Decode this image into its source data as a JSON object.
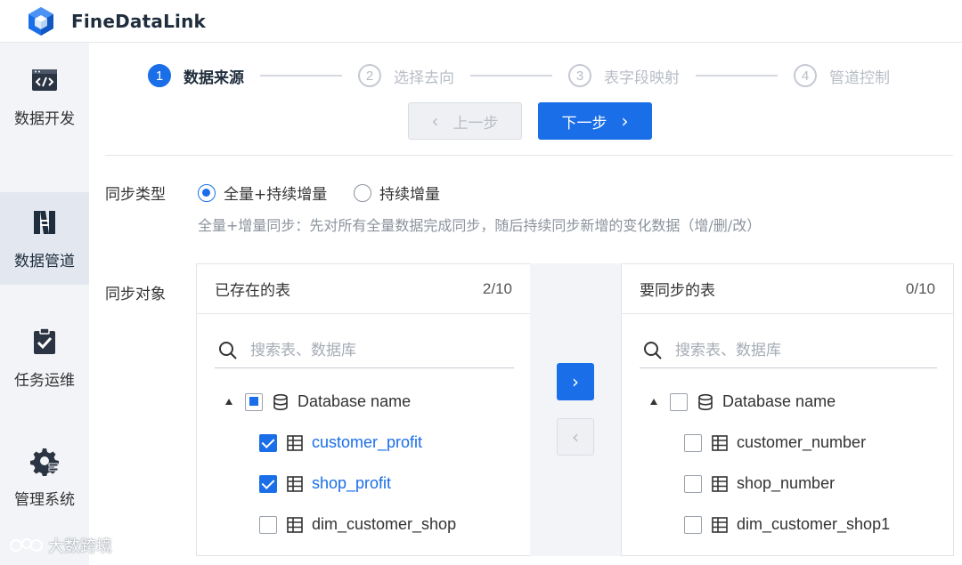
{
  "app": {
    "title": "FineDataLink"
  },
  "sidebar": {
    "items": [
      {
        "label": "数据开发",
        "icon": "code-icon",
        "active": false
      },
      {
        "label": "数据管道",
        "icon": "pipeline-icon",
        "active": true
      },
      {
        "label": "任务运维",
        "icon": "task-check-icon",
        "active": false
      },
      {
        "label": "管理系统",
        "icon": "gear-icon",
        "active": false
      }
    ]
  },
  "steps": [
    {
      "num": "1",
      "label": "数据来源",
      "active": true
    },
    {
      "num": "2",
      "label": "选择去向",
      "active": false
    },
    {
      "num": "3",
      "label": "表字段映射",
      "active": false
    },
    {
      "num": "4",
      "label": "管道控制",
      "active": false
    }
  ],
  "nav": {
    "prev_label": "上一步",
    "next_label": "下一步"
  },
  "sync_type": {
    "label": "同步类型",
    "options": [
      {
        "label": "全量+持续增量",
        "selected": true
      },
      {
        "label": "持续增量",
        "selected": false
      }
    ],
    "description": "全量+增量同步：先对所有全量数据完成同步，随后持续同步新增的变化数据（增/删/改）"
  },
  "sync_object": {
    "label": "同步对象",
    "source": {
      "title": "已存在的表",
      "count": "2/10",
      "search_placeholder": "搜索表、数据库",
      "database": "Database name",
      "tables": [
        {
          "name": "customer_profit",
          "checked": true
        },
        {
          "name": "shop_profit",
          "checked": true
        },
        {
          "name": "dim_customer_shop",
          "checked": false
        }
      ]
    },
    "target": {
      "title": "要同步的表",
      "count": "0/10",
      "search_placeholder": "搜索表、数据库",
      "database": "Database name",
      "tables": [
        {
          "name": "customer_number",
          "checked": false
        },
        {
          "name": "shop_number",
          "checked": false
        },
        {
          "name": "dim_customer_shop1",
          "checked": false
        }
      ]
    }
  },
  "watermark": {
    "text": "大数跨境"
  },
  "colors": {
    "primary": "#1a6ee8",
    "sidebar_bg": "#f2f4f7",
    "sidebar_active": "#e3e8f0"
  }
}
